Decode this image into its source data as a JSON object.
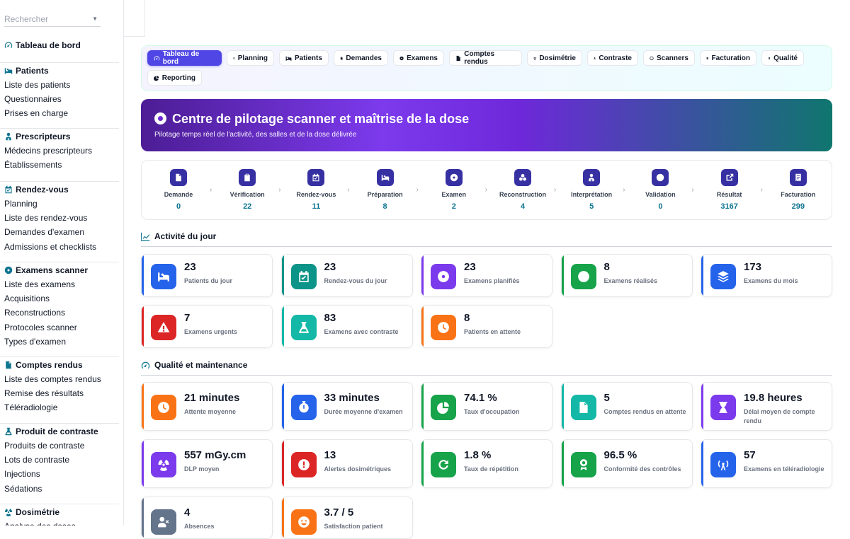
{
  "search": {
    "placeholder": "Rechercher"
  },
  "sidebar": {
    "groups": [
      {
        "label": "Tableau de bord",
        "icon": "gauge-icon",
        "items": []
      },
      {
        "label": "Patients",
        "icon": "bed-icon",
        "items": [
          "Liste des patients",
          "Questionnaires",
          "Prises en charge"
        ]
      },
      {
        "label": "Prescripteurs",
        "icon": "doctor-icon",
        "items": [
          "Médecins prescripteurs",
          "Établissements"
        ]
      },
      {
        "label": "Rendez-vous",
        "icon": "calendar-check-icon",
        "items": [
          "Planning",
          "Liste des rendez-vous",
          "Demandes d'examen",
          "Admissions et checklists"
        ]
      },
      {
        "label": "Examens scanner",
        "icon": "disc-icon",
        "items": [
          "Liste des examens",
          "Acquisitions",
          "Reconstructions",
          "Protocoles scanner",
          "Types d'examen"
        ]
      },
      {
        "label": "Comptes rendus",
        "icon": "document-icon",
        "items": [
          "Liste des comptes rendus",
          "Remise des résultats",
          "Téléradiologie"
        ]
      },
      {
        "label": "Produit de contraste",
        "icon": "flask-icon",
        "items": [
          "Produits de contraste",
          "Lots de contraste",
          "Injections",
          "Sédations"
        ]
      },
      {
        "label": "Dosimétrie",
        "icon": "radiation-icon",
        "items": [
          "Analyse des doses"
        ]
      }
    ]
  },
  "tabs": [
    {
      "label": "Tableau de bord",
      "icon": "gauge-icon",
      "active": true
    },
    {
      "label": "Planning",
      "icon": "calendar-icon"
    },
    {
      "label": "Patients",
      "icon": "bed-icon"
    },
    {
      "label": "Demandes",
      "icon": "document-icon"
    },
    {
      "label": "Examens",
      "icon": "disc-icon"
    },
    {
      "label": "Comptes rendus",
      "icon": "document-icon"
    },
    {
      "label": "Dosimétrie",
      "icon": "radiation-icon"
    },
    {
      "label": "Contraste",
      "icon": "flask-icon"
    },
    {
      "label": "Scanners",
      "icon": "ring-icon"
    },
    {
      "label": "Facturation",
      "icon": "invoice-icon"
    },
    {
      "label": "Qualité",
      "icon": "award-icon"
    },
    {
      "label": "Reporting",
      "icon": "pie-icon"
    }
  ],
  "hero": {
    "title": "Centre de pilotage scanner et maîtrise de la dose",
    "subtitle": "Pilotage temps réel de l'activité, des salles et de la dose délivrée"
  },
  "pipeline": [
    {
      "label": "Demande",
      "value": "0",
      "icon": "document-icon"
    },
    {
      "label": "Vérification",
      "value": "22",
      "icon": "clipboard-icon"
    },
    {
      "label": "Rendez-vous",
      "value": "11",
      "icon": "calendar-check-icon"
    },
    {
      "label": "Préparation",
      "value": "8",
      "icon": "bed-icon"
    },
    {
      "label": "Examen",
      "value": "2",
      "icon": "disc-icon"
    },
    {
      "label": "Reconstruction",
      "value": "4",
      "icon": "cubes-icon"
    },
    {
      "label": "Interprétation",
      "value": "5",
      "icon": "doctor-icon"
    },
    {
      "label": "Validation",
      "value": "0",
      "icon": "check-circle-icon"
    },
    {
      "label": "Résultat",
      "value": "3167",
      "icon": "share-icon"
    },
    {
      "label": "Facturation",
      "value": "299",
      "icon": "invoice-icon"
    }
  ],
  "activity": {
    "title": "Activité du jour",
    "cards": [
      {
        "value": "23",
        "label": "Patients du jour",
        "color": "#2563eb",
        "icon": "bed-icon"
      },
      {
        "value": "23",
        "label": "Rendez-vous du jour",
        "color": "#0d9488",
        "icon": "calendar-check-icon"
      },
      {
        "value": "23",
        "label": "Examens planifiés",
        "color": "#7c3aed",
        "icon": "disc-icon"
      },
      {
        "value": "8",
        "label": "Examens réalisés",
        "color": "#16a34a",
        "icon": "check-circle-icon"
      },
      {
        "value": "173",
        "label": "Examens du mois",
        "color": "#2563eb",
        "icon": "layers-icon"
      },
      {
        "value": "7",
        "label": "Examens urgents",
        "color": "#dc2626",
        "icon": "warning-icon"
      },
      {
        "value": "83",
        "label": "Examens avec contraste",
        "color": "#14b8a6",
        "icon": "flask-icon"
      },
      {
        "value": "8",
        "label": "Patients en attente",
        "color": "#f97316",
        "icon": "clock-icon"
      }
    ]
  },
  "quality": {
    "title": "Qualité et maintenance",
    "cards": [
      {
        "value": "21 minutes",
        "label": "Attente moyenne",
        "color": "#f97316",
        "icon": "clock-icon"
      },
      {
        "value": "33 minutes",
        "label": "Durée moyenne d'examen",
        "color": "#2563eb",
        "icon": "stopwatch-icon"
      },
      {
        "value": "74.1 %",
        "label": "Taux d'occupation",
        "color": "#16a34a",
        "icon": "pie-icon"
      },
      {
        "value": "5",
        "label": "Comptes rendus en attente",
        "color": "#14b8a6",
        "icon": "document-icon"
      },
      {
        "value": "19.8 heures",
        "label": "Délai moyen de compte rendu",
        "color": "#7c3aed",
        "icon": "hourglass-icon"
      },
      {
        "value": "557 mGy.cm",
        "label": "DLP moyen",
        "color": "#7c3aed",
        "icon": "radiation-icon"
      },
      {
        "value": "13",
        "label": "Alertes dosimétriques",
        "color": "#dc2626",
        "icon": "alert-icon"
      },
      {
        "value": "1.8 %",
        "label": "Taux de répétition",
        "color": "#16a34a",
        "icon": "redo-icon"
      },
      {
        "value": "96.5 %",
        "label": "Conformité des contrôles",
        "color": "#16a34a",
        "icon": "award-icon"
      },
      {
        "value": "57",
        "label": "Examens en téléradiologie",
        "color": "#2563eb",
        "icon": "tower-icon"
      },
      {
        "value": "4",
        "label": "Absences",
        "color": "#64748b",
        "icon": "user-x-icon"
      },
      {
        "value": "3.7 / 5",
        "label": "Satisfaction patient",
        "color": "#f97316",
        "icon": "smile-icon"
      }
    ]
  }
}
